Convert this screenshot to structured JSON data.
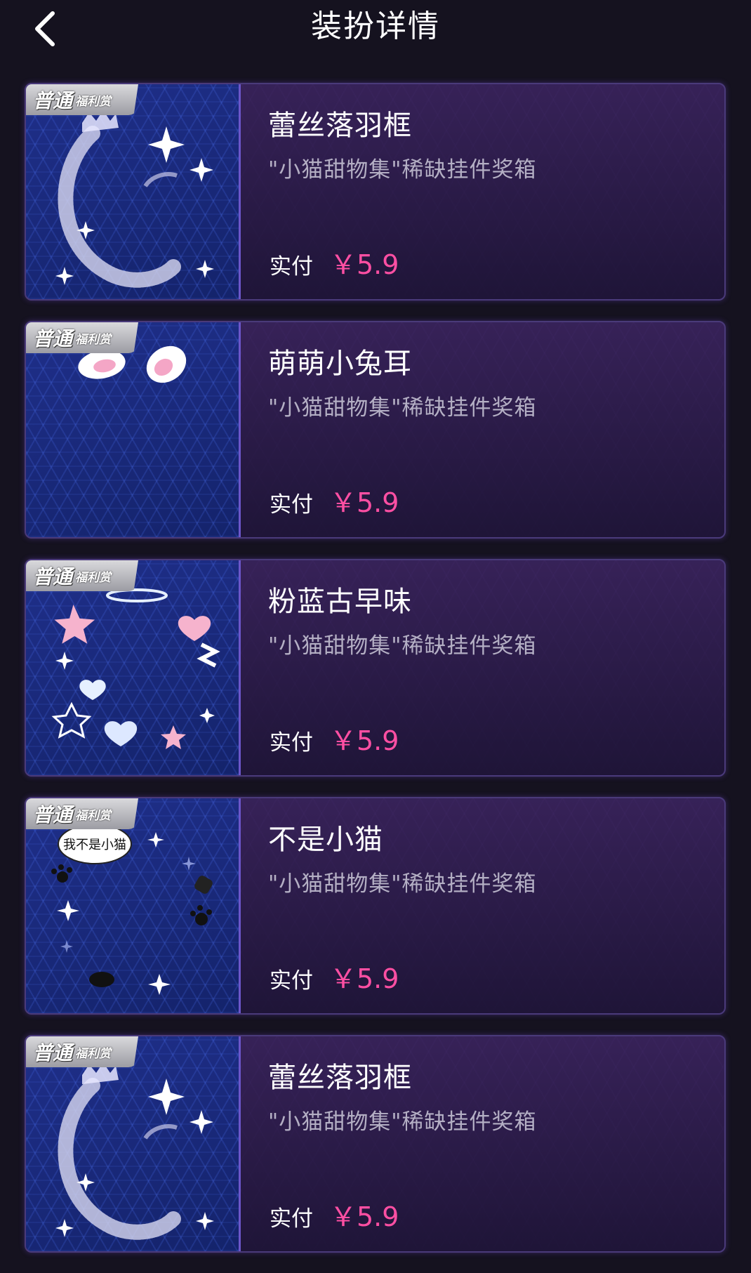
{
  "header": {
    "title": "装扮详情",
    "back_icon": "chevron-left-icon"
  },
  "items": [
    {
      "badge_main": "普通",
      "badge_sub": "福利赏",
      "name": "蕾丝落羽框",
      "source": "\"小猫甜物集\"稀缺挂件奖箱",
      "pay_label": "实付",
      "price": "￥5.9",
      "art": "lace-feather-frame"
    },
    {
      "badge_main": "普通",
      "badge_sub": "福利赏",
      "name": "萌萌小兔耳",
      "source": "\"小猫甜物集\"稀缺挂件奖箱",
      "pay_label": "实付",
      "price": "￥5.9",
      "art": "bunny-ears"
    },
    {
      "badge_main": "普通",
      "badge_sub": "福利赏",
      "name": "粉蓝古早味",
      "source": "\"小猫甜物集\"稀缺挂件奖箱",
      "pay_label": "实付",
      "price": "￥5.9",
      "art": "pink-blue-retro-frame"
    },
    {
      "badge_main": "普通",
      "badge_sub": "福利赏",
      "name": "不是小猫",
      "source": "\"小猫甜物集\"稀缺挂件奖箱",
      "pay_label": "实付",
      "price": "￥5.9",
      "art": "not-a-cat-frame",
      "art_text": "我不是小猫"
    },
    {
      "badge_main": "普通",
      "badge_sub": "福利赏",
      "name": "蕾丝落羽框",
      "source": "\"小猫甜物集\"稀缺挂件奖箱",
      "pay_label": "实付",
      "price": "￥5.9",
      "art": "lace-feather-frame"
    }
  ],
  "colors": {
    "background": "#15121f",
    "price": "#ff4fa3",
    "card_border": "#4a3a7a",
    "thumb_border": "#6c56c9"
  }
}
